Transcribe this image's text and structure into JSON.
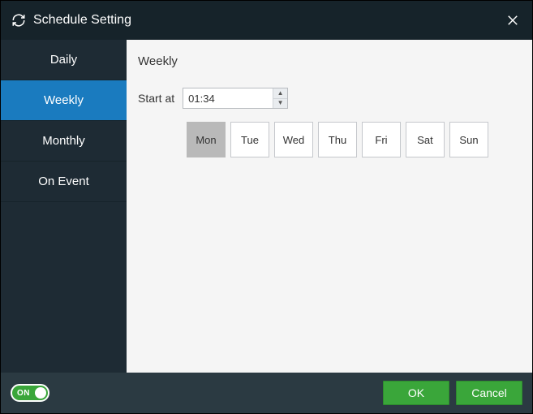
{
  "window": {
    "title": "Schedule Setting"
  },
  "sidebar": {
    "items": [
      {
        "label": "Daily",
        "active": false
      },
      {
        "label": "Weekly",
        "active": true
      },
      {
        "label": "Monthly",
        "active": false
      },
      {
        "label": "On Event",
        "active": false
      }
    ]
  },
  "main": {
    "title": "Weekly",
    "start_label": "Start at",
    "start_value": "01:34",
    "days": [
      {
        "label": "Mon",
        "selected": true
      },
      {
        "label": "Tue",
        "selected": false
      },
      {
        "label": "Wed",
        "selected": false
      },
      {
        "label": "Thu",
        "selected": false
      },
      {
        "label": "Fri",
        "selected": false
      },
      {
        "label": "Sat",
        "selected": false
      },
      {
        "label": "Sun",
        "selected": false
      }
    ]
  },
  "footer": {
    "toggle_label": "ON",
    "toggle_value": true,
    "ok_label": "OK",
    "cancel_label": "Cancel"
  },
  "colors": {
    "accent": "#1a7bbf",
    "success": "#3aa63a",
    "panel_dark": "#1e2b34",
    "panel_darker": "#16232a",
    "footer": "#2b3a42"
  }
}
